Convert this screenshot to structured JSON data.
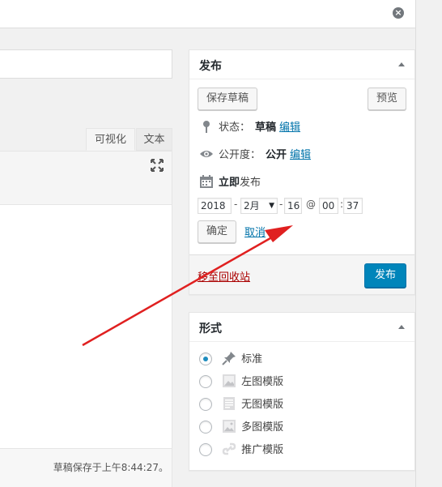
{
  "header": {
    "close_icon": "close-icon"
  },
  "editor": {
    "tabs": [
      {
        "label": "可视化",
        "active": true
      },
      {
        "label": "文本",
        "active": false
      }
    ],
    "status_text": "草稿保存于上午8:44:27。"
  },
  "publish": {
    "title": "发布",
    "save_draft": "保存草稿",
    "preview": "预览",
    "status_label": "状态：",
    "status_value": "草稿",
    "visibility_label": "公开度：",
    "visibility_value": "公开",
    "edit_label": "编辑",
    "schedule_bold": "立即",
    "schedule_rest": "发布",
    "date": {
      "year": "2018",
      "month": "2月",
      "day": "16",
      "at": "@",
      "hour": "00",
      "minute": "37"
    },
    "ok": "确定",
    "cancel": "取消",
    "trash": "移至回收站",
    "publish_button": "发布",
    "accent_color": "#0085ba"
  },
  "format": {
    "title": "形式",
    "options": [
      {
        "label": "标准",
        "icon": "pin-icon",
        "checked": true
      },
      {
        "label": "左图模版",
        "icon": "image-icon",
        "checked": false
      },
      {
        "label": "无图模版",
        "icon": "text-icon",
        "checked": false
      },
      {
        "label": "多图模版",
        "icon": "gallery-icon",
        "checked": false
      },
      {
        "label": "推广模版",
        "icon": "link-icon",
        "checked": false
      }
    ]
  },
  "annotation": {
    "arrow_color": "#e02020"
  }
}
